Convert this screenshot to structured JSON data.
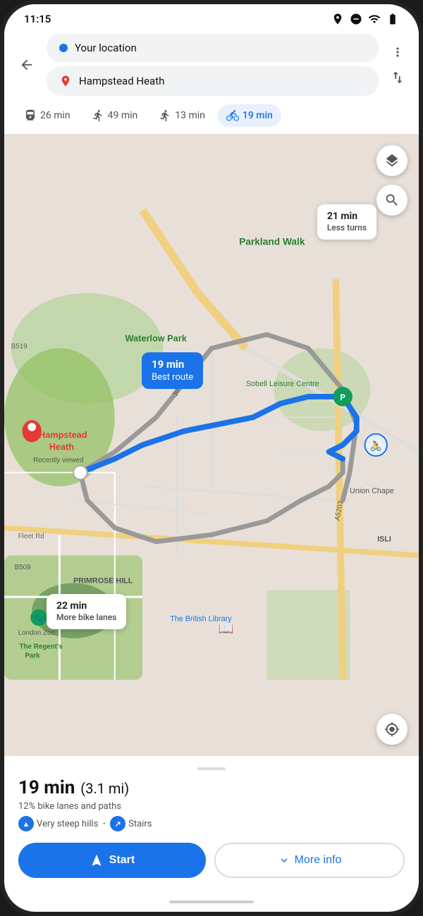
{
  "status": {
    "time": "11:15",
    "icons": [
      "location",
      "dnd",
      "wifi",
      "battery"
    ]
  },
  "nav": {
    "back_label": "←",
    "origin": {
      "placeholder": "Your location",
      "value": "Your location"
    },
    "destination": {
      "placeholder": "Hampstead Heath",
      "value": "Hampstead Heath"
    },
    "more_label": "⋮",
    "swap_label": "⇅"
  },
  "transport_tabs": [
    {
      "id": "transit",
      "icon": "🚇",
      "label": "26 min",
      "active": false
    },
    {
      "id": "walk",
      "icon": "🚶",
      "label": "49 min",
      "active": false
    },
    {
      "id": "walk2",
      "icon": "🧍",
      "label": "13 min",
      "active": false
    },
    {
      "id": "bike",
      "icon": "🚴",
      "label": "19 min",
      "active": true
    }
  ],
  "map": {
    "layers_icon": "◈",
    "search_icon": "🔍",
    "location_icon": "◎",
    "route_best": {
      "time": "19 min",
      "label": "Best route"
    },
    "route_alt1": {
      "time": "21 min",
      "label": "Less turns"
    },
    "route_alt2": {
      "time": "22 min",
      "label": "More bike lanes"
    },
    "place_labels": [
      "Parkland Walk",
      "Waterlow Park",
      "Hampstead Heath",
      "Recently viewed",
      "Sobell Leisure Centre",
      "Fleet Rd",
      "Union Chape",
      "PRIMROSE HILL",
      "London Zoo",
      "The Regent's Park",
      "The British Library",
      "ISLI"
    ]
  },
  "bottom": {
    "time": "19 min",
    "distance": "(3.1 mi)",
    "description": "12% bike lanes and paths",
    "warning1": "Very steep hills",
    "warning2": "Stairs",
    "start_label": "Start",
    "more_label": "More info"
  }
}
